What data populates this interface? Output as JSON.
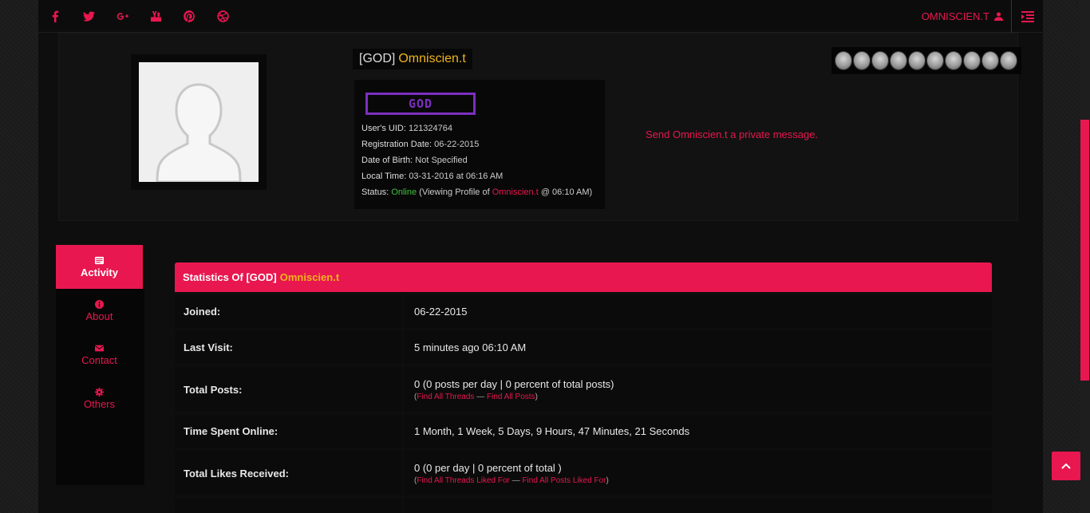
{
  "topbar": {
    "social_icons": [
      "facebook-icon",
      "twitter-icon",
      "google-plus-icon",
      "youtube-icon",
      "pinterest-icon",
      "dribbble-icon"
    ],
    "user_label": "OMNISCIEN.T",
    "menu_icon": "menu-toggle-icon"
  },
  "profile": {
    "tag": "[GOD]",
    "name": "Omniscien.t",
    "badge": "GOD",
    "uid_label": "User's UID:",
    "uid": "121324764",
    "reg_label": "Registration Date:",
    "reg": "06-22-2015",
    "dob_label": "Date of Birth:",
    "dob": "Not Specified",
    "local_label": "Local Time:",
    "local": "03-31-2016 at 06:16 AM",
    "status_label": "Status:",
    "status": "Online",
    "status_pre": "(Viewing Profile of",
    "status_user": "Omniscien.t",
    "status_post": "@ 06:10 AM)",
    "pm_link": "Send Omniscien.t a private message.",
    "award_count": 10
  },
  "nav": [
    {
      "label": "Activity",
      "icon": "card-icon",
      "active": true
    },
    {
      "label": "About",
      "icon": "info-icon",
      "active": false
    },
    {
      "label": "Contact",
      "icon": "envelope-icon",
      "active": false
    },
    {
      "label": "Others",
      "icon": "gear-icon",
      "active": false
    }
  ],
  "stats": {
    "title_pre": "Statistics Of [GOD]",
    "title_name": "Omniscien.t",
    "rows": [
      {
        "key": "Joined:",
        "value": "06-22-2015"
      },
      {
        "key": "Last Visit:",
        "value": "5 minutes ago 06:10 AM"
      },
      {
        "key": "Total Posts:",
        "value": "0 (0 posts per day | 0 percent of total posts)",
        "link1": "Find All Threads",
        "link2": "Find All Posts"
      },
      {
        "key": "Time Spent Online:",
        "value": "1 Month, 1 Week, 5 Days, 9 Hours, 47 Minutes, 21 Seconds"
      },
      {
        "key": "Total Likes Received:",
        "value": "0 (0 per day | 0 percent of total )",
        "link1": "Find All Threads Liked For",
        "link2": "Find All Posts Liked For"
      }
    ]
  }
}
